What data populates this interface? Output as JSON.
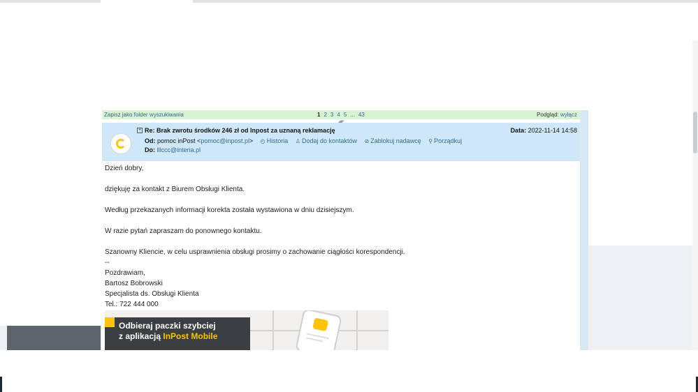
{
  "nav_bar": {
    "save_folder": "Zapisz jako folder wyszukiwania",
    "pages": [
      "1",
      "2",
      "3",
      "4",
      "5",
      "...",
      "43"
    ],
    "preview_label": "Podgląd:",
    "preview_link": "wyłącz"
  },
  "message": {
    "subject": "Re: Brak zwrotu środków 246 zł od Inpost za uznaną reklamację",
    "date_label": "Data:",
    "date_value": "2022-11-14 14:58",
    "from_label": "Od:",
    "from_name": "pomoc inPost <",
    "from_email": "pomoc@inpost.pl",
    "from_close": ">",
    "to_label": "Do:",
    "to_email": "lllccc@interia.pl",
    "actions": {
      "history": "Historia",
      "add_contact": "Dodaj do kontaktów",
      "block_sender": "Zablokuj nadawcę",
      "organize": "Porządkuj"
    }
  },
  "body": {
    "greeting": "Dzień dobry,",
    "line1": "dziękuję za kontakt z Biurem Obsługi Klienta.",
    "line2": "Według przekazanych informacji korekta została wystawiona w dniu dzisiejszym.",
    "line3": "W razie pytań zapraszam do ponownego kontaktu.",
    "line4": "Szanowny Kliencie, w celu usprawnienia obsługi prosimy o zachowanie ciągłości korespondencji.",
    "separator": "--",
    "regards": "Pozdrawiam,",
    "name": "Bartosz Bobrowski",
    "position": "Specjalista ds. Obsługi Klienta",
    "phone": "Tel.: 722 444 000"
  },
  "banner": {
    "line1": "Odbieraj paczki szybciej",
    "line2_prefix": "z aplikacją ",
    "line2_highlight": "InPost Mobile"
  },
  "colors": {
    "header_bg": "#cfe8f8",
    "nav_bg": "#d9f2d4",
    "link": "#2f6d8f",
    "banner_dark": "#3b3f42",
    "inpost_yellow": "#ffc20e"
  }
}
